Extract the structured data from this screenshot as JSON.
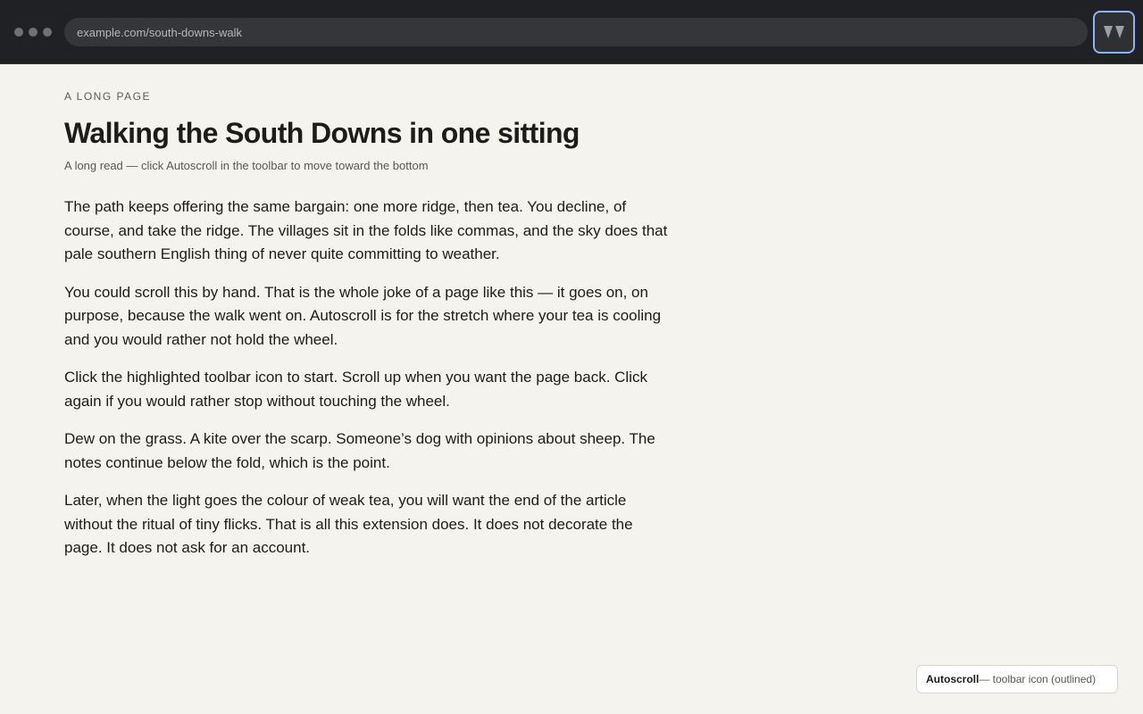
{
  "browser": {
    "url": "example.com/south-downs-walk",
    "extension": {
      "icon": "autoscroll-double-chevron-icon",
      "highlight_color": "#8ab4f8"
    }
  },
  "article": {
    "kicker": "A LONG PAGE",
    "title": "Walking the South Downs in one sitting",
    "subtitle": "A long read — click Autoscroll in the toolbar to move toward the bottom",
    "paragraphs": [
      "The path keeps offering the same bargain: one more ridge, then tea. You decline, of course, and take the ridge. The villages sit in the folds like commas, and the sky does that pale southern English thing of never quite committing to weather.",
      "You could scroll this by hand. That is the whole joke of a page like this — it goes on, on purpose, because the walk went on. Autoscroll is for the stretch where your tea is cooling and you would rather not hold the wheel.",
      "Click the highlighted toolbar icon to start. Scroll up when you want the page back. Click again if you would rather stop without touching the wheel.",
      "Dew on the grass. A kite over the scarp. Someone’s dog with opinions about sheep. The notes continue below the fold, which is the point.",
      "Later, when the light goes the colour of weak tea, you will want the end of the article without the ritual of tiny flicks. That is all this extension does. It does not decorate the page. It does not ask for an account."
    ]
  },
  "hint": {
    "name": "Autoscroll",
    "rest": " — toolbar icon (outlined)"
  }
}
